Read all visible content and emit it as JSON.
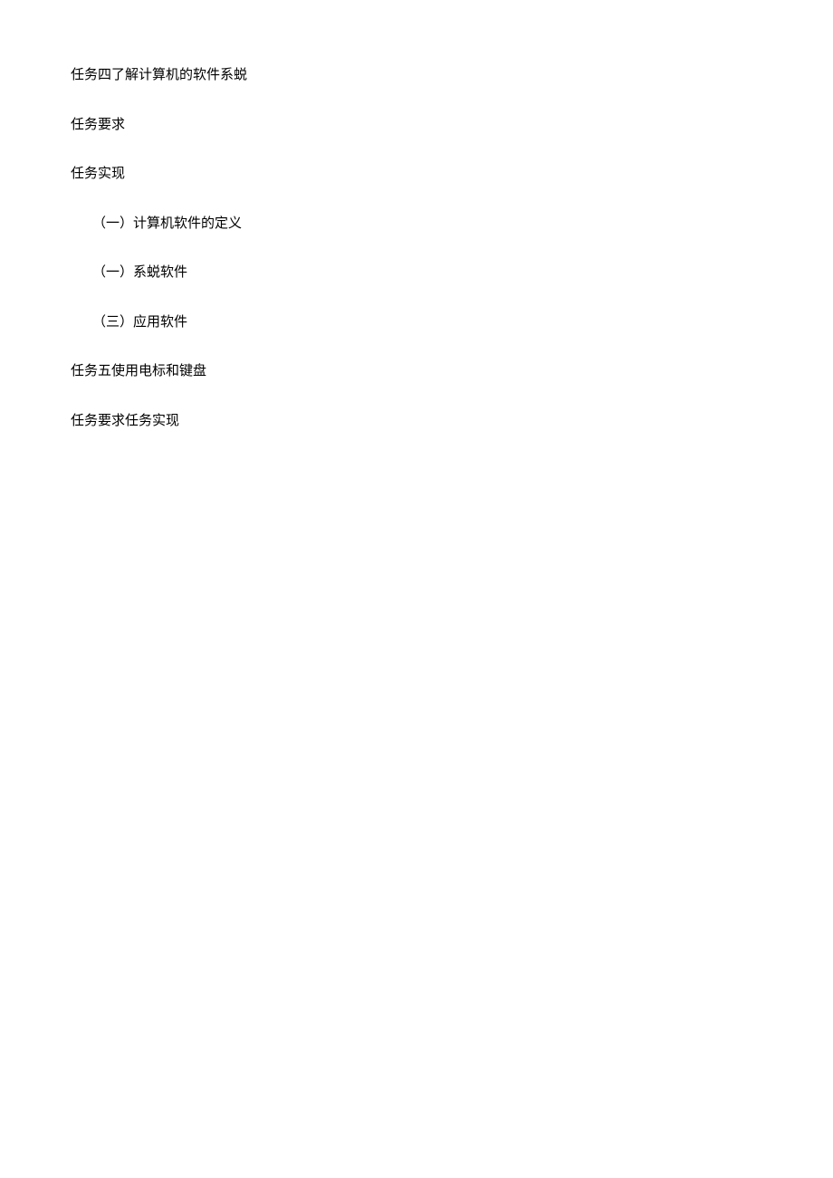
{
  "lines": {
    "task4_title": "任务四了解计算机的软件系蜕",
    "task_req_1": "任务要求",
    "task_impl_1": "任务实现",
    "item_1": "（一）计算机软件的定义",
    "item_2": "（一）系蜕软件",
    "item_3": "（三）应用软件",
    "task5_title": "任务五使用电标和键盘",
    "task_req_impl": "任务要求任务实现"
  }
}
